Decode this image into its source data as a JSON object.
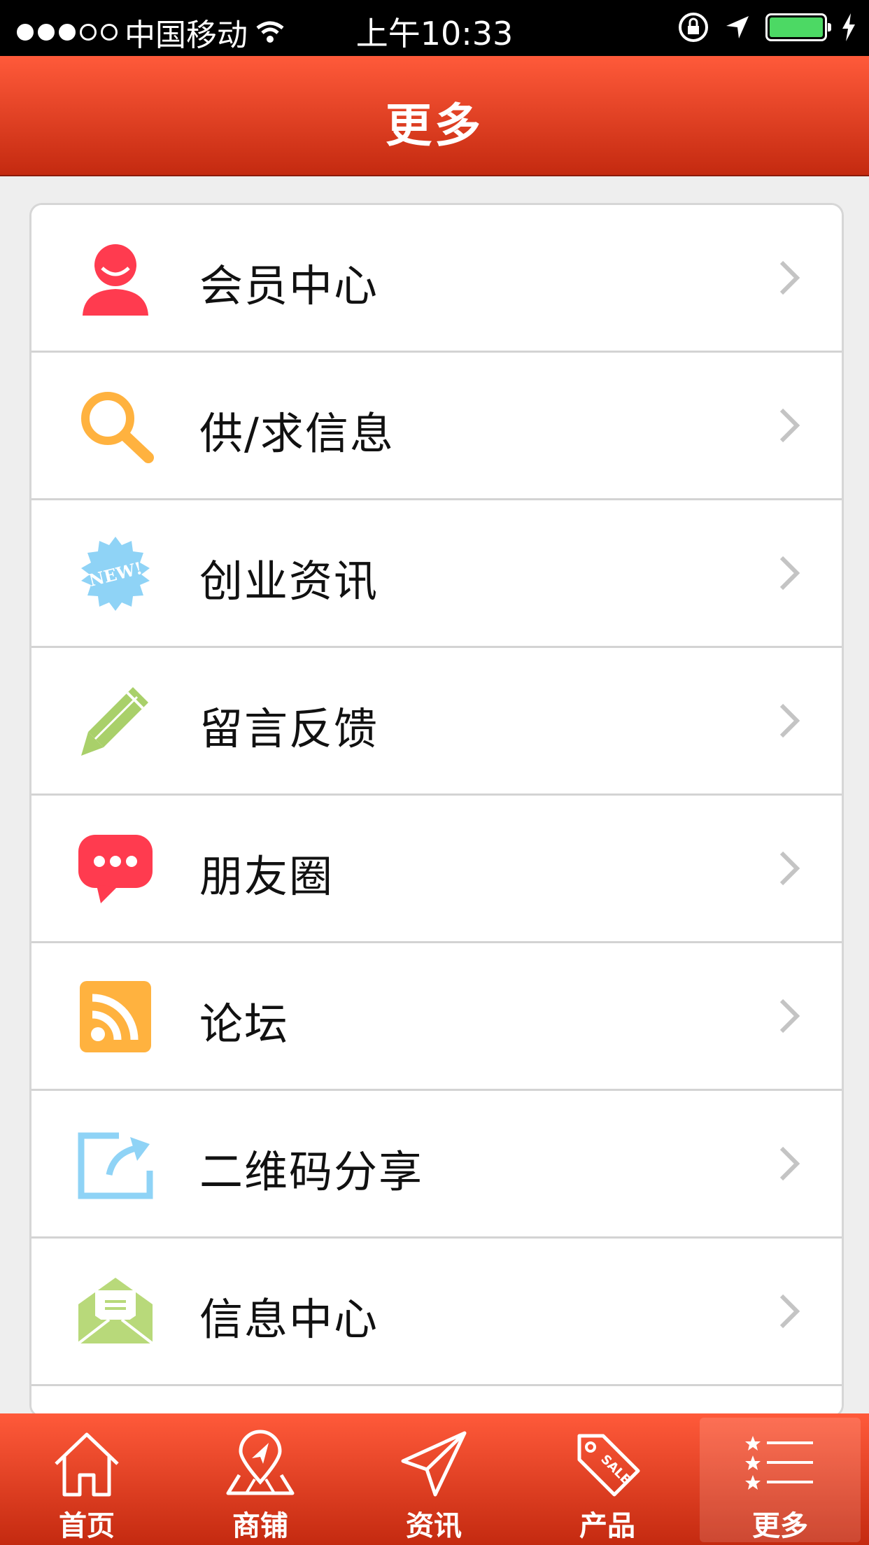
{
  "status_bar": {
    "carrier": "中国移动",
    "time": "上午10:33"
  },
  "header": {
    "title": "更多"
  },
  "menu": {
    "items": [
      {
        "label": "会员中心",
        "icon": "user-icon",
        "color": "#ff3b4f"
      },
      {
        "label": "供/求信息",
        "icon": "search-icon",
        "color": "#ffb23f"
      },
      {
        "label": "创业资讯",
        "icon": "new-badge-icon",
        "color": "#8fd3f6",
        "badge_text": "NEW!"
      },
      {
        "label": "留言反馈",
        "icon": "pencil-icon",
        "color": "#a9d06a"
      },
      {
        "label": "朋友圈",
        "icon": "chat-bubble-icon",
        "color": "#ff3b4f"
      },
      {
        "label": "论坛",
        "icon": "rss-icon",
        "color": "#ffb23f"
      },
      {
        "label": "二维码分享",
        "icon": "share-icon",
        "color": "#8fd3f6"
      },
      {
        "label": "信息中心",
        "icon": "envelope-icon",
        "color": "#b8d97a"
      }
    ]
  },
  "tabbar": {
    "tabs": [
      {
        "label": "首页",
        "icon": "home-icon"
      },
      {
        "label": "商铺",
        "icon": "map-pin-icon"
      },
      {
        "label": "资讯",
        "icon": "paper-plane-icon"
      },
      {
        "label": "产品",
        "icon": "sale-tag-icon",
        "tag_text": "SALE"
      },
      {
        "label": "更多",
        "icon": "star-list-icon",
        "active": true
      }
    ]
  },
  "colors": {
    "header_top": "#ff5a3a",
    "header_bottom": "#c42a10",
    "background": "#eeeeee"
  }
}
